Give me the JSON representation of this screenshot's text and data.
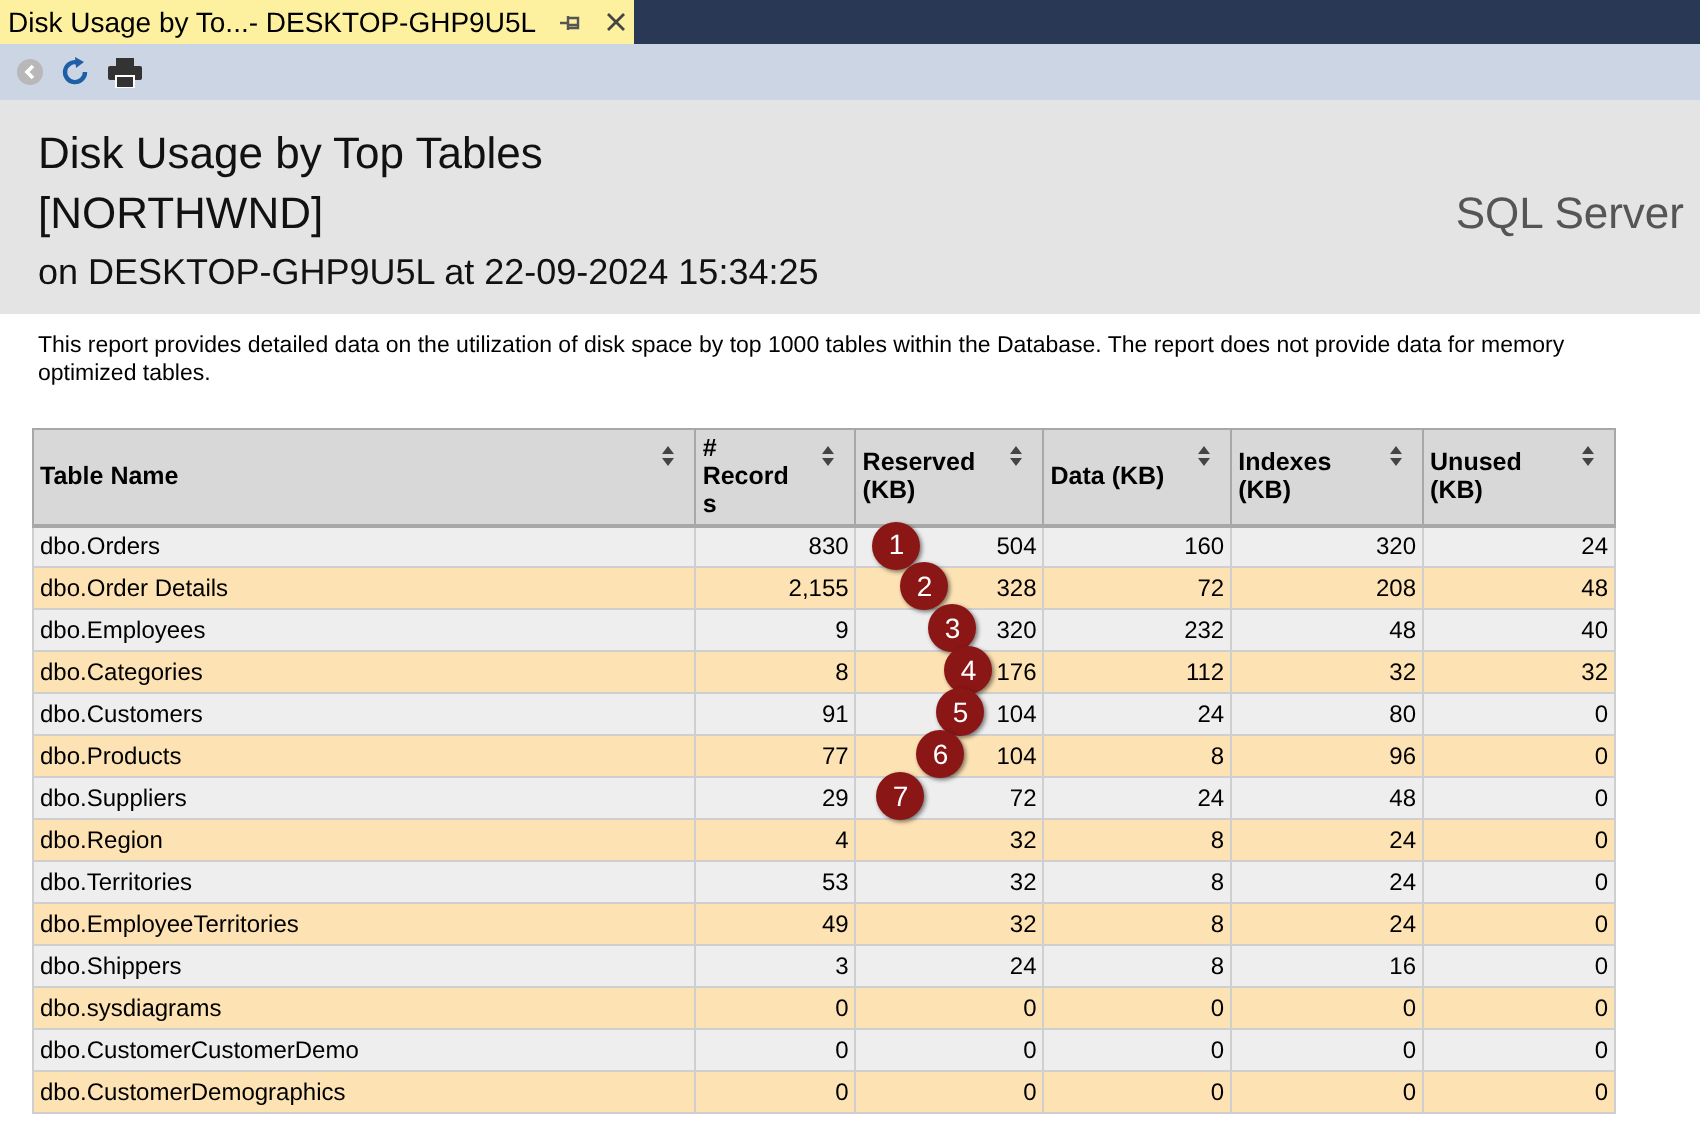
{
  "tab": {
    "title": "Disk Usage by To...- DESKTOP-GHP9U5L",
    "selected": true
  },
  "report": {
    "title": "Disk Usage by Top Tables",
    "database": "[NORTHWND]",
    "subtitle": "on DESKTOP-GHP9U5L at 22-09-2024 15:34:25",
    "product": "SQL Server",
    "description": "This report provides detailed data on the utilization of disk space by top 1000 tables within the Database. The report does not provide data for memory optimized tables."
  },
  "table": {
    "columns": [
      "Table Name",
      "# Record s",
      "Reserved (KB)",
      "Data (KB)",
      "Indexes (KB)",
      "Unused (KB)"
    ],
    "rows": [
      {
        "cells": [
          "dbo.Orders",
          "830",
          "504",
          "160",
          "320",
          "24"
        ],
        "marker": "1"
      },
      {
        "cells": [
          "dbo.Order Details",
          "2,155",
          "328",
          "72",
          "208",
          "48"
        ],
        "marker": "2"
      },
      {
        "cells": [
          "dbo.Employees",
          "9",
          "320",
          "232",
          "48",
          "40"
        ],
        "marker": "3"
      },
      {
        "cells": [
          "dbo.Categories",
          "8",
          "176",
          "112",
          "32",
          "32"
        ],
        "marker": "4"
      },
      {
        "cells": [
          "dbo.Customers",
          "91",
          "104",
          "24",
          "80",
          "0"
        ],
        "marker": "5"
      },
      {
        "cells": [
          "dbo.Products",
          "77",
          "104",
          "8",
          "96",
          "0"
        ],
        "marker": "6"
      },
      {
        "cells": [
          "dbo.Suppliers",
          "29",
          "72",
          "24",
          "48",
          "0"
        ],
        "marker": "7"
      },
      {
        "cells": [
          "dbo.Region",
          "4",
          "32",
          "8",
          "24",
          "0"
        ]
      },
      {
        "cells": [
          "dbo.Territories",
          "53",
          "32",
          "8",
          "24",
          "0"
        ]
      },
      {
        "cells": [
          "dbo.EmployeeTerritories",
          "49",
          "32",
          "8",
          "24",
          "0"
        ]
      },
      {
        "cells": [
          "dbo.Shippers",
          "3",
          "24",
          "8",
          "16",
          "0"
        ]
      },
      {
        "cells": [
          "dbo.sysdiagrams",
          "0",
          "0",
          "0",
          "0",
          "0"
        ]
      },
      {
        "cells": [
          "dbo.CustomerCustomerDemo",
          "0",
          "0",
          "0",
          "0",
          "0"
        ]
      },
      {
        "cells": [
          "dbo.CustomerDemographics",
          "0",
          "0",
          "0",
          "0",
          "0"
        ]
      }
    ]
  }
}
